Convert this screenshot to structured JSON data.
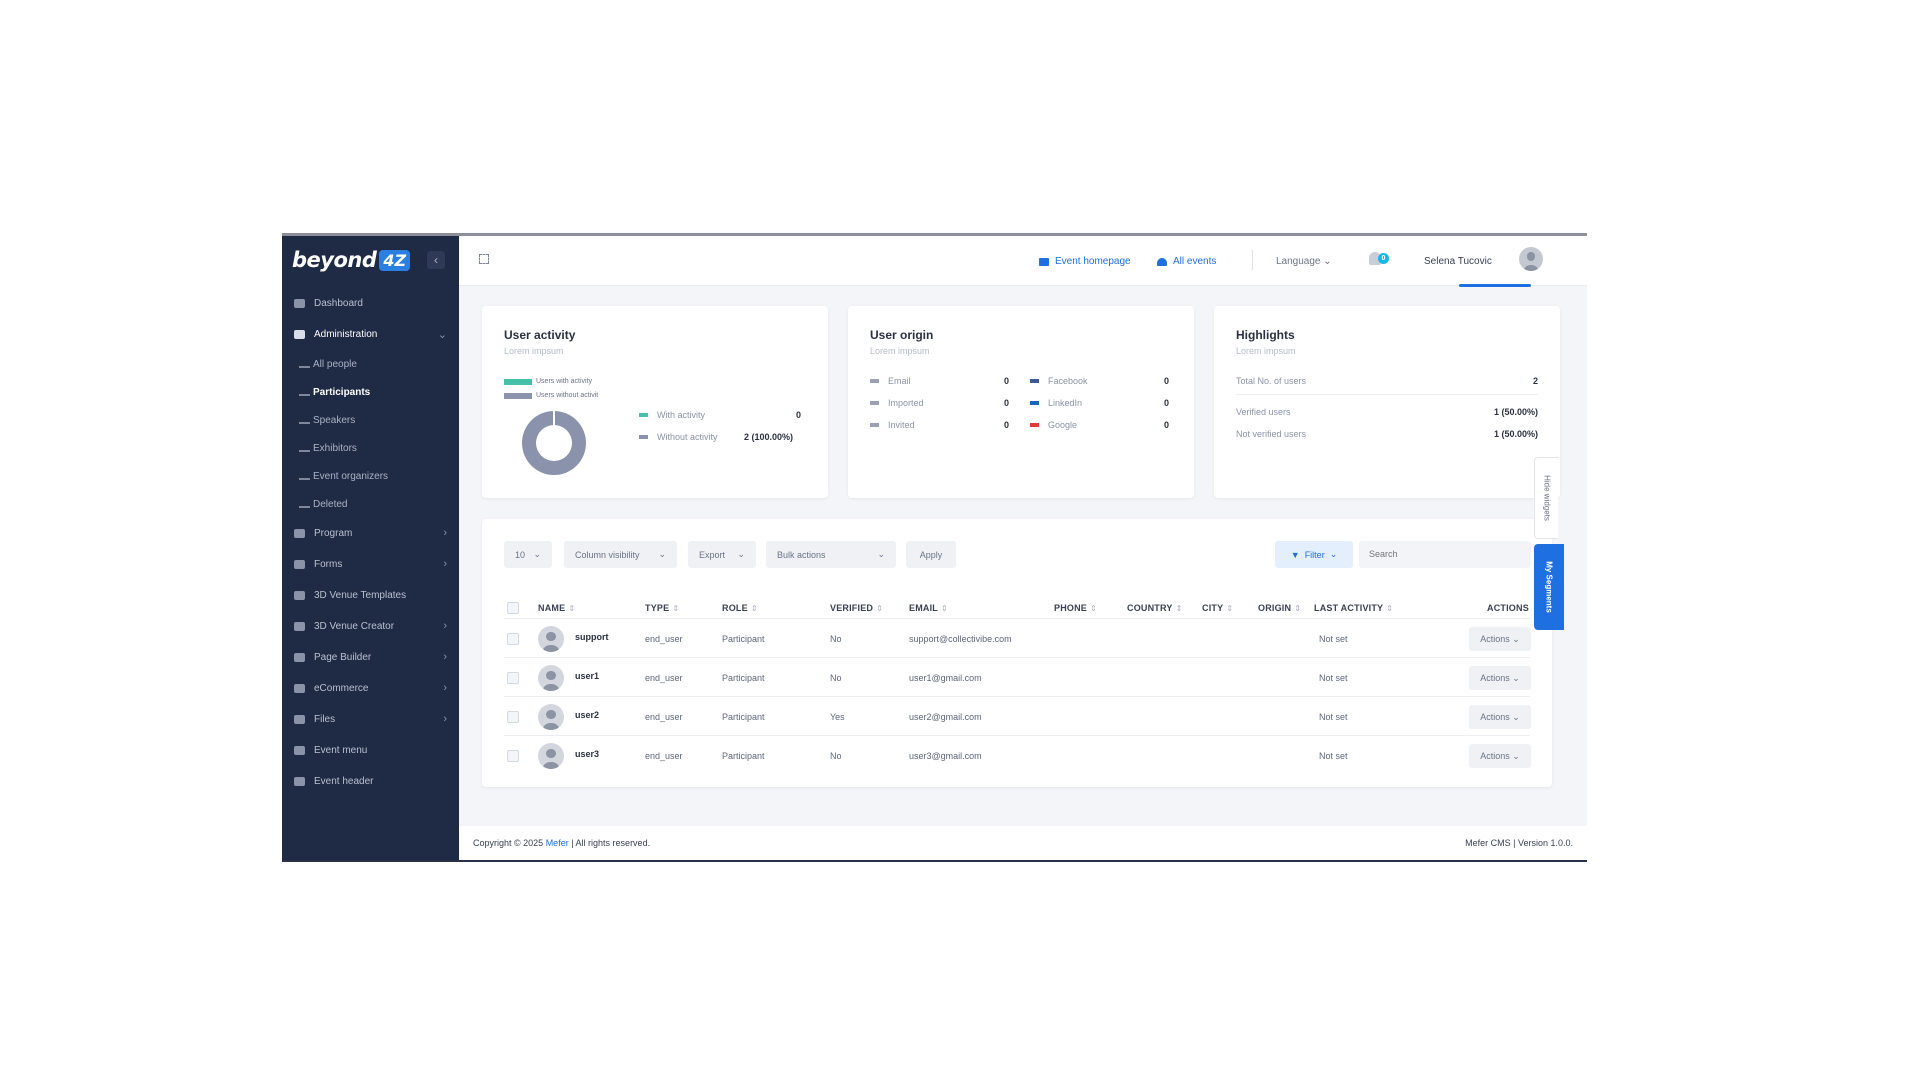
{
  "brand": {
    "logo_text": "beyond",
    "logo_badge": "4Z"
  },
  "sidebar": {
    "items": [
      {
        "label": "Dashboard"
      },
      {
        "label": "Administration"
      },
      {
        "label": "Program"
      },
      {
        "label": "Forms"
      },
      {
        "label": "3D Venue Templates"
      },
      {
        "label": "3D Venue Creator"
      },
      {
        "label": "Page Builder"
      },
      {
        "label": "eCommerce"
      },
      {
        "label": "Files"
      },
      {
        "label": "Event menu"
      },
      {
        "label": "Event header"
      }
    ],
    "admin_sub": [
      {
        "label": "All people"
      },
      {
        "label": "Participants"
      },
      {
        "label": "Speakers"
      },
      {
        "label": "Exhibitors"
      },
      {
        "label": "Event organizers"
      },
      {
        "label": "Deleted"
      }
    ]
  },
  "topbar": {
    "event_homepage": "Event homepage",
    "all_events": "All events",
    "language": "Language",
    "notif_count": "0",
    "user_name": "Selena Tucovic"
  },
  "user_activity": {
    "title": "User activity",
    "subtitle": "Lorem impsum",
    "legend_with": "Users with activity",
    "legend_without": "Users without activit",
    "with_label": "With activity",
    "with_value": "0",
    "without_label": "Without activity",
    "without_value": "2 (100.00%)",
    "colors": {
      "with": "#45c1a9",
      "without": "#8a93ab"
    }
  },
  "user_origin": {
    "title": "User origin",
    "subtitle": "Lorem impsum",
    "left": [
      {
        "label": "Email",
        "value": "0"
      },
      {
        "label": "Imported",
        "value": "0"
      },
      {
        "label": "Invited",
        "value": "0"
      }
    ],
    "right": [
      {
        "label": "Facebook",
        "value": "0",
        "color": "#3b5998"
      },
      {
        "label": "LinkedIn",
        "value": "0",
        "color": "#1565c0"
      },
      {
        "label": "Google",
        "value": "0",
        "color": "#e53935"
      }
    ]
  },
  "highlights": {
    "title": "Highlights",
    "subtitle": "Lorem impsum",
    "total_label": "Total No. of users",
    "total_value": "2",
    "verified_label": "Verified users",
    "verified_value": "1 (50.00%)",
    "not_verified_label": "Not verified users",
    "not_verified_value": "1 (50.00%)"
  },
  "table_controls": {
    "page_size": "10",
    "column_visibility": "Column visibility",
    "export": "Export",
    "bulk_actions": "Bulk actions",
    "apply": "Apply",
    "filter": "Filter",
    "search_placeholder": "Search"
  },
  "table": {
    "headers": [
      "NAME",
      "TYPE",
      "ROLE",
      "VERIFIED",
      "EMAIL",
      "PHONE",
      "COUNTRY",
      "CITY",
      "ORIGIN",
      "LAST ACTIVITY",
      "ACTIONS"
    ],
    "rows": [
      {
        "name": "support",
        "type": "end_user",
        "role": "Participant",
        "verified": "No",
        "email": "support@collectivibe.com",
        "last_activity": "Not set",
        "action": "Actions"
      },
      {
        "name": "user1",
        "type": "end_user",
        "role": "Participant",
        "verified": "No",
        "email": "user1@gmail.com",
        "last_activity": "Not set",
        "action": "Actions"
      },
      {
        "name": "user2",
        "type": "end_user",
        "role": "Participant",
        "verified": "Yes",
        "email": "user2@gmail.com",
        "last_activity": "Not set",
        "action": "Actions"
      },
      {
        "name": "user3",
        "type": "end_user",
        "role": "Participant",
        "verified": "No",
        "email": "user3@gmail.com",
        "last_activity": "Not set",
        "action": "Actions"
      }
    ]
  },
  "side_tabs": {
    "hide_widgets": "Hide widgets",
    "my_segments": "My Segments"
  },
  "footer": {
    "copyright_prefix": "Copyright © 2025 ",
    "copyright_brand": "Mefer",
    "copyright_suffix": " | All rights reserved.",
    "version": "Mefer CMS | Version 1.0.0."
  },
  "colors": {
    "sidebar_bg": "#1f2a45",
    "accent": "#1e6fe0"
  }
}
